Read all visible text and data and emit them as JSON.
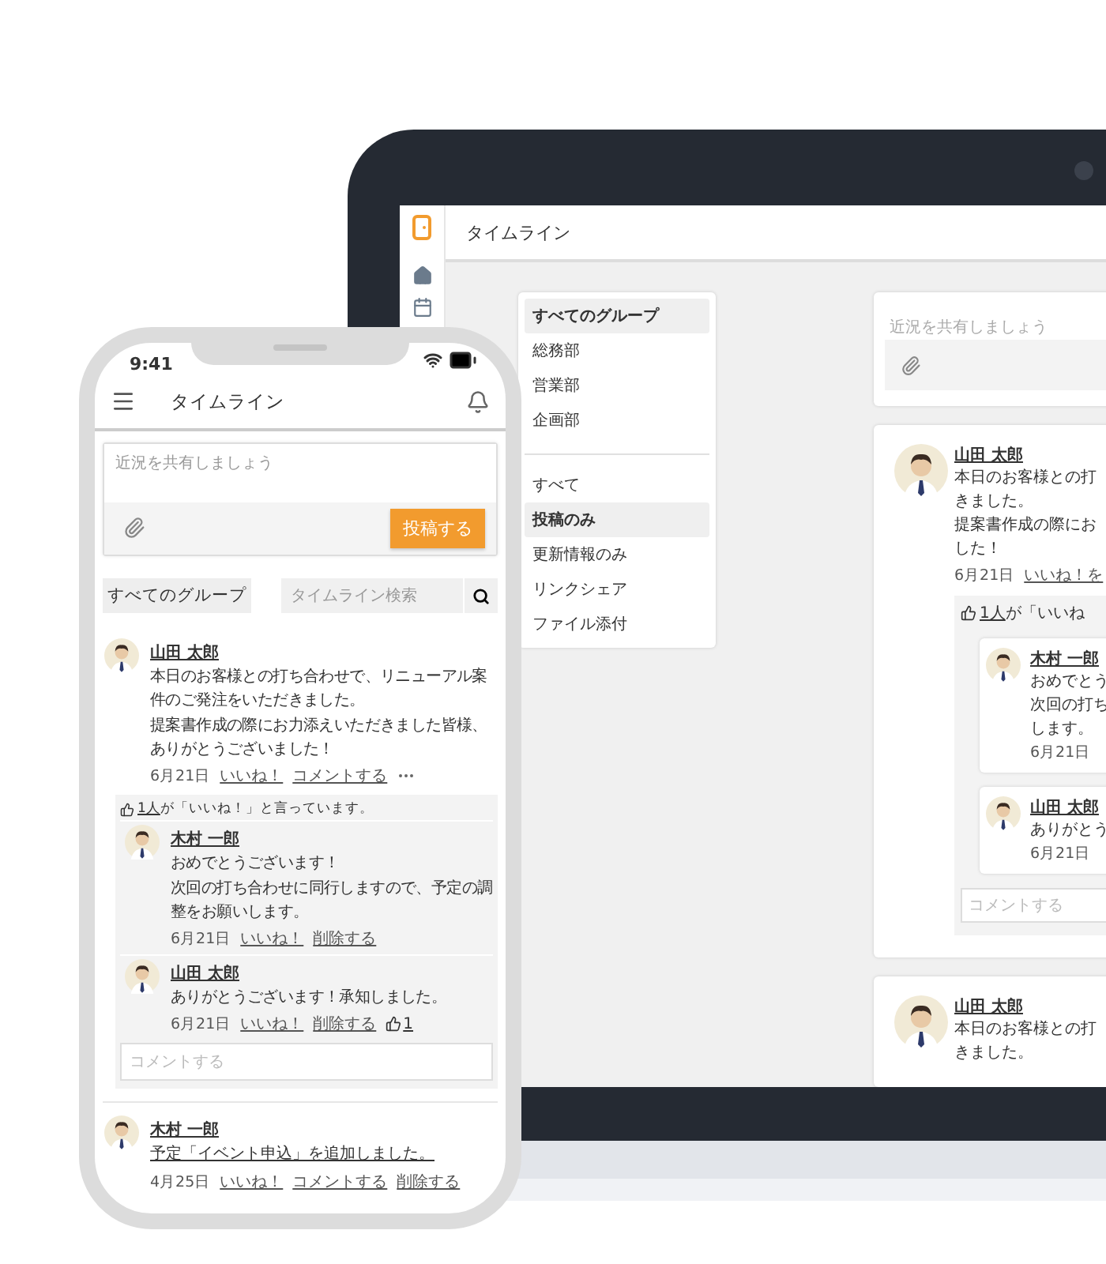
{
  "laptop": {
    "title": "タイムライン",
    "groups": [
      {
        "label": "すべてのグループ",
        "selected": true
      },
      {
        "label": "総務部",
        "selected": false
      },
      {
        "label": "営業部",
        "selected": false
      },
      {
        "label": "企画部",
        "selected": false
      }
    ],
    "filters": [
      {
        "label": "すべて",
        "selected": false
      },
      {
        "label": "投稿のみ",
        "selected": true
      },
      {
        "label": "更新情報のみ",
        "selected": false
      },
      {
        "label": "リンクシェア",
        "selected": false
      },
      {
        "label": "ファイル添付",
        "selected": false
      }
    ],
    "composer": {
      "placeholder": "近況を共有しましょう"
    },
    "posts": [
      {
        "author": "山田 太郎",
        "lines": [
          "本日のお客様との打",
          "きました。",
          "提案書作成の際にお",
          "した！"
        ],
        "date": "6月21日",
        "actions": [
          "いいね！を"
        ],
        "likes": {
          "count": "1人",
          "text": "が「いいね"
        },
        "comments": [
          {
            "author": "木村 一郎",
            "lines": [
              "おめでとう",
              "次回の打ち",
              "します。"
            ],
            "date": "6月21日"
          },
          {
            "author": "山田 太郎",
            "lines": [
              "ありがとう"
            ],
            "date": "6月21日"
          }
        ],
        "comment_placeholder": "コメントする"
      },
      {
        "author": "山田 太郎",
        "lines": [
          "本日のお客様との打",
          "きました。"
        ]
      }
    ]
  },
  "phone": {
    "time": "9:41",
    "title": "タイムライン",
    "composer": {
      "placeholder": "近況を共有しましょう",
      "submit": "投稿する"
    },
    "group_filter": "すべてのグループ",
    "search": {
      "placeholder": "タイムライン検索"
    },
    "posts": [
      {
        "kind": "message",
        "author": "山田 太郎",
        "lines": [
          "本日のお客様との打ち合わせで、リニューアル案件のご発注をいただきました。",
          "提案書作成の際にお力添えいただきました皆様、ありがとうございました！"
        ],
        "date": "6月21日",
        "actions": [
          "いいね！",
          "コメントする"
        ],
        "likes": {
          "count": "1人",
          "text": "が「いいね！」と言っています。"
        },
        "comments": [
          {
            "author": "木村 一郎",
            "lines": [
              "おめでとうございます！",
              "次回の打ち合わせに同行しますので、予定の調整をお願いします。"
            ],
            "date": "6月21日",
            "actions": [
              "いいね！",
              "削除する"
            ]
          },
          {
            "author": "山田 太郎",
            "lines": [
              "ありがとうございます！承知しました。"
            ],
            "date": "6月21日",
            "actions": [
              "いいね！",
              "削除する"
            ],
            "like_count": "1"
          }
        ],
        "comment_placeholder": "コメントする"
      },
      {
        "kind": "update",
        "author": "木村 一郎",
        "lines": [
          "予定「イベント申込」を追加しました。"
        ],
        "date": "4月25日",
        "actions": [
          "いいね！",
          "コメントする",
          "削除する"
        ]
      }
    ]
  }
}
